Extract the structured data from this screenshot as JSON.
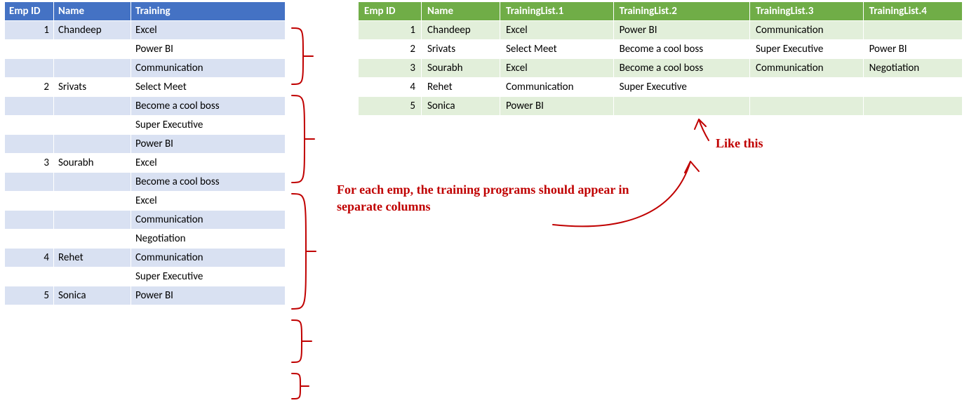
{
  "leftTable": {
    "headers": [
      "Emp ID",
      "Name",
      "Training"
    ],
    "rows": [
      {
        "id": "1",
        "name": "Chandeep",
        "training": "Excel"
      },
      {
        "id": "",
        "name": "",
        "training": "Power BI"
      },
      {
        "id": "",
        "name": "",
        "training": "Communication"
      },
      {
        "id": "2",
        "name": "Srivats",
        "training": "Select Meet"
      },
      {
        "id": "",
        "name": "",
        "training": "Become a cool boss"
      },
      {
        "id": "",
        "name": "",
        "training": "Super Executive"
      },
      {
        "id": "",
        "name": "",
        "training": "Power BI"
      },
      {
        "id": "3",
        "name": "Sourabh",
        "training": "Excel"
      },
      {
        "id": "",
        "name": "",
        "training": "Become a cool boss"
      },
      {
        "id": "",
        "name": "",
        "training": "Excel"
      },
      {
        "id": "",
        "name": "",
        "training": "Communication"
      },
      {
        "id": "",
        "name": "",
        "training": "Negotiation"
      },
      {
        "id": "4",
        "name": "Rehet",
        "training": "Communication"
      },
      {
        "id": "",
        "name": "",
        "training": "Super Executive"
      },
      {
        "id": "5",
        "name": "Sonica",
        "training": "Power BI"
      }
    ]
  },
  "rightTable": {
    "headers": [
      "Emp ID",
      "Name",
      "TrainingList.1",
      "TrainingList.2",
      "TrainingList.3",
      "TrainingList.4"
    ],
    "rows": [
      {
        "id": "1",
        "name": "Chandeep",
        "t1": "Excel",
        "t2": "Power BI",
        "t3": "Communication",
        "t4": ""
      },
      {
        "id": "2",
        "name": "Srivats",
        "t1": "Select Meet",
        "t2": "Become a cool boss",
        "t3": "Super Executive",
        "t4": "Power BI"
      },
      {
        "id": "3",
        "name": "Sourabh",
        "t1": "Excel",
        "t2": "Become a cool boss",
        "t3": "Communication",
        "t4": "Negotiation"
      },
      {
        "id": "4",
        "name": "Rehet",
        "t1": "Communication",
        "t2": "Super Executive",
        "t3": "",
        "t4": ""
      },
      {
        "id": "5",
        "name": "Sonica",
        "t1": "Power BI",
        "t2": "",
        "t3": "",
        "t4": ""
      }
    ]
  },
  "annotations": {
    "main": "For each emp, the training programs should appear in separate columns",
    "like": "Like this"
  }
}
